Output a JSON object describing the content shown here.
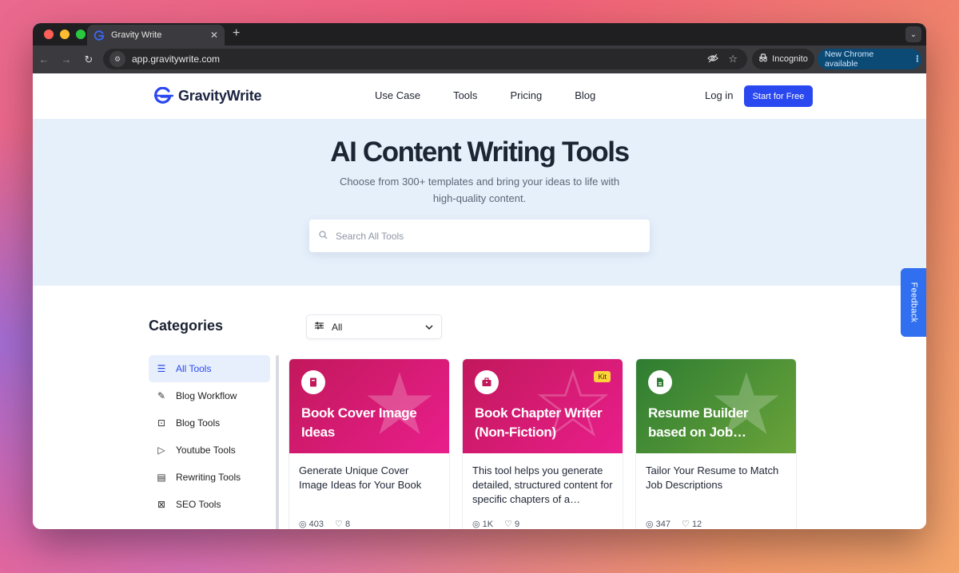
{
  "browser": {
    "tab_title": "Gravity Write",
    "url": "app.gravitywrite.com",
    "incognito_label": "Incognito",
    "update_label": "New Chrome available"
  },
  "header": {
    "brand": "GravityWrite",
    "nav": [
      "Use Case",
      "Tools",
      "Pricing",
      "Blog"
    ],
    "login": "Log in",
    "cta": "Start for Free"
  },
  "hero": {
    "title": "AI Content Writing Tools",
    "subtitle": "Choose from 300+ templates and bring your ideas to life with high-quality content.",
    "search_placeholder": "Search All Tools"
  },
  "feedback_label": "Feedback",
  "categories": {
    "title": "Categories",
    "filter_value": "All",
    "items": [
      {
        "label": "All Tools",
        "icon": "list-icon"
      },
      {
        "label": "Blog Workflow",
        "icon": "edit-box-icon"
      },
      {
        "label": "Blog Tools",
        "icon": "browser-search-icon"
      },
      {
        "label": "Youtube Tools",
        "icon": "play-icon"
      },
      {
        "label": "Rewriting Tools",
        "icon": "document-icon"
      },
      {
        "label": "SEO Tools",
        "icon": "search-page-icon"
      }
    ]
  },
  "cards": [
    {
      "title": "Book Cover Image Ideas",
      "description": "Generate Unique Cover Image Ideas for Your Book",
      "icon": "book-icon",
      "badge": "",
      "views": "403",
      "likes": "8",
      "color": "#c2185b"
    },
    {
      "title": "Book Chapter Writer (Non-Fiction)",
      "description": "This tool helps you generate detailed, structured content for specific chapters of a…",
      "icon": "briefcase-icon",
      "badge": "Kit",
      "views": "1K",
      "likes": "9",
      "color": "#c2185b"
    },
    {
      "title": "Resume Builder based on Job…",
      "description": "Tailor Your Resume to Match Job Descriptions",
      "icon": "file-icon",
      "badge": "",
      "views": "347",
      "likes": "12",
      "color": "#2e7d32"
    }
  ]
}
